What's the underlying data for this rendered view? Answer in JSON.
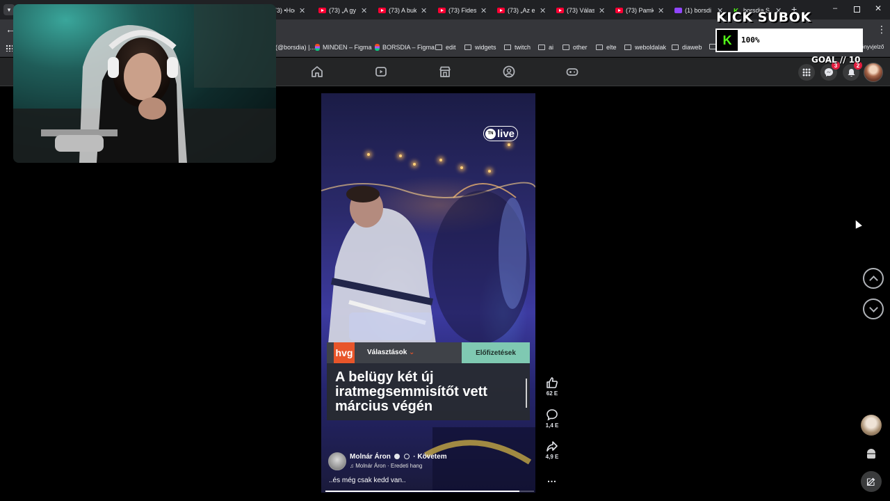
{
  "browser": {
    "tabs": [
      {
        "label": "(73) •Hogy",
        "icon": "youtube-icon"
      },
      {
        "label": "(73) „A gy",
        "icon": "youtube-icon"
      },
      {
        "label": "(73) A buk",
        "icon": "youtube-icon"
      },
      {
        "label": "(73) Fidesz",
        "icon": "youtube-icon"
      },
      {
        "label": "(73) „Az e",
        "icon": "youtube-icon"
      },
      {
        "label": "(73) Válasz",
        "icon": "youtube-icon"
      },
      {
        "label": "(73) Pamk",
        "icon": "youtube-icon"
      },
      {
        "label": "(1) borsdi",
        "icon": "twitch-icon"
      },
      {
        "label": "borsdia S",
        "icon": "kick-icon"
      }
    ],
    "new_tab": "+",
    "bookmarks": [
      {
        "label": "(@borsdia) |...",
        "type": "page"
      },
      {
        "label": "MINDEN – Figma",
        "type": "figma"
      },
      {
        "label": "BORSDIA – Figma",
        "type": "figma"
      },
      {
        "label": "edit",
        "type": "folder"
      },
      {
        "label": "widgets",
        "type": "folder"
      },
      {
        "label": "twitch",
        "type": "folder"
      },
      {
        "label": "ai",
        "type": "folder"
      },
      {
        "label": "other",
        "type": "folder"
      },
      {
        "label": "elte",
        "type": "folder"
      },
      {
        "label": "weboldalak",
        "type": "folder"
      },
      {
        "label": "diaweb",
        "type": "folder"
      },
      {
        "label": "",
        "type": "folder"
      }
    ],
    "bookmarks_tail": "önyvjelző"
  },
  "overlay": {
    "kick_title": "KICK SUBOK",
    "kick_logo": "K",
    "kick_percent": "100%",
    "goal": "GOAL // 10"
  },
  "facebook": {
    "nav": [
      "home-icon",
      "video-icon",
      "marketplace-icon",
      "groups-icon",
      "gaming-icon"
    ],
    "messenger_badge": "3",
    "notifications_badge": "2"
  },
  "reel": {
    "live_badge": "live",
    "live_prefix": "TN",
    "hvg": {
      "logo": "hvg",
      "section": "Választások",
      "subscribe": "Előfizetések",
      "headline": "A belügy két új iratmegsemmisítőt vett március végén"
    },
    "author": "Molnár Áron",
    "follow": "· Követem",
    "audio": "Molnár Áron · Eredeti hang",
    "caption": "..és még csak kedd van..",
    "progress": 0.93,
    "likes": "62 E",
    "comments": "1,4 E",
    "shares": "4,9 E"
  },
  "colors": {
    "kick_green": "#53fc18",
    "hvg_orange": "#e8552a",
    "hvg_teal": "#7fc9b2",
    "fb_bar": "#242526"
  }
}
